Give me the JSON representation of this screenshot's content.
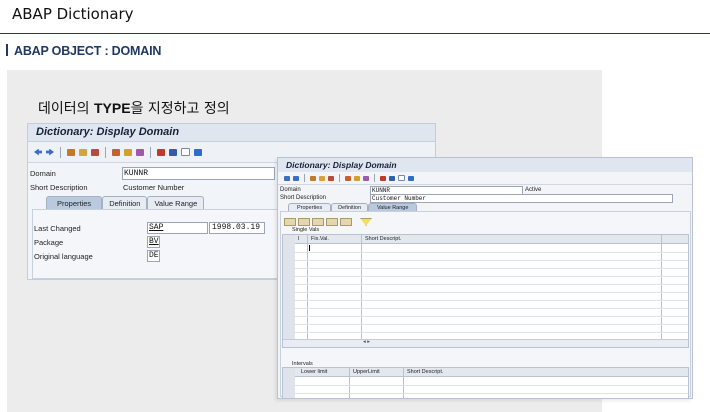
{
  "slide": {
    "header": "ABAP Dictionary",
    "section": "ABAP OBJECT : DOMAIN",
    "caption_pre": "데이터의 ",
    "caption_bold": "TYPE",
    "caption_post": "을 지정하고 정의"
  },
  "window1": {
    "title": "Dictionary: Display Domain",
    "toolbar_icons": [
      "back-icon",
      "forward-icon",
      "other-object-icon",
      "display-change-icon",
      "check-icon",
      "activate-icon",
      "where-used-icon",
      "edit-icon",
      "navigate-icon",
      "hierarchy-icon",
      "list-icon",
      "window-icon",
      "info-icon"
    ],
    "domain_label": "Domain",
    "domain_value": "KUNNR",
    "short_desc_label": "Short Description",
    "short_desc_value": "Customer Number",
    "tabs": [
      "Properties",
      "Definition",
      "Value Range"
    ],
    "last_changed_label": "Last Changed",
    "last_changed_user": "SAP",
    "last_changed_date": "1998.03.19",
    "package_label": "Package",
    "package_value": "BV",
    "orig_lang_label": "Original language",
    "orig_lang_value": "DE"
  },
  "window2": {
    "title": "Dictionary: Display Domain",
    "domain_label": "Domain",
    "domain_value": "KUNNR",
    "status": "Active",
    "short_desc_label": "Short Description",
    "short_desc_value": "Customer Number",
    "tabs": [
      "Properties",
      "Definition",
      "Value Range"
    ],
    "single_vals_label": "Single Vals",
    "col_flag": "I",
    "col_fixval": "Fix.Val.",
    "col_shortdesc": "Short Descript.",
    "scroll_arrows": "◂ ▸",
    "intervals_label": "Intervals",
    "col_lower": "Lower limit",
    "col_upper": "UpperLimit",
    "col_int_desc": "Short Descript."
  },
  "colors": {
    "navy": "#1f3864",
    "sap_title_bg": "#dfe6ef",
    "active_tab": "#b9c9de",
    "slide_grey": "#ececec"
  }
}
